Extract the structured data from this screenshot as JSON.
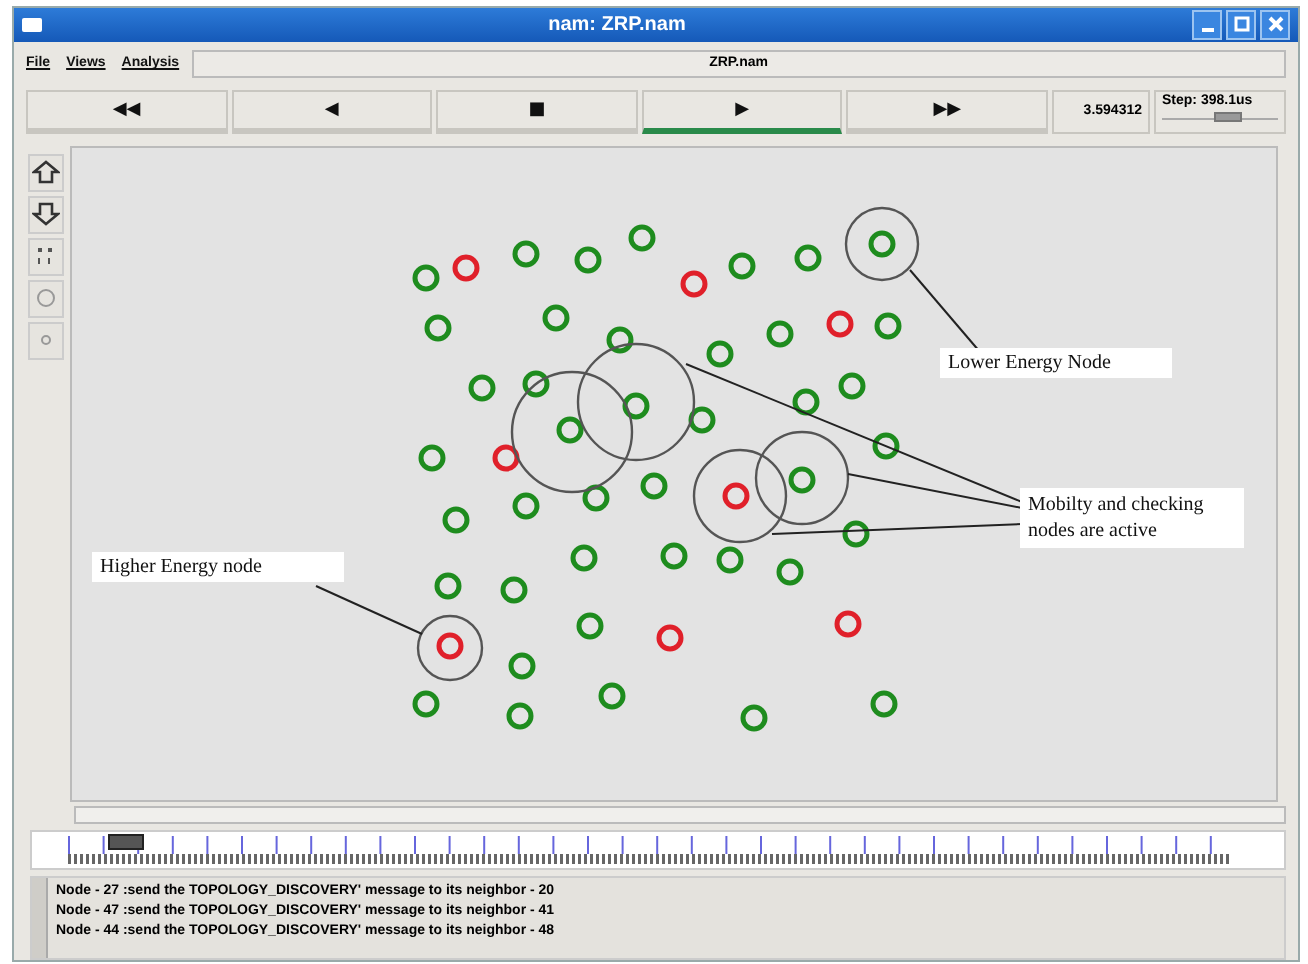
{
  "window": {
    "title": "nam: ZRP.nam"
  },
  "menu": [
    "File",
    "Views",
    "Analysis"
  ],
  "file_label": "ZRP.nam",
  "controls": [
    {
      "label": "◀◀",
      "selected": false
    },
    {
      "label": "◀",
      "selected": false
    },
    {
      "label": "■",
      "selected": false
    },
    {
      "label": "▶",
      "selected": true
    },
    {
      "label": "▶▶",
      "selected": false
    }
  ],
  "time": "3.594312",
  "step": "Step: 398.1us",
  "step_slider": {
    "level": 0.55
  },
  "nodes": [
    {
      "color": "#1e8c1e"
    },
    {
      "color": "#e0202a"
    },
    {
      "color": "#1e8c1e"
    },
    {
      "color": "#1e8c1e"
    },
    {
      "color": "#1e8c1e"
    },
    {
      "color": "#e0202a"
    },
    {
      "color": "#1e8c1e"
    },
    {
      "color": "#1e8c1e"
    },
    {
      "color": "#1e8c1e"
    },
    {
      "color": "#1e8c1e"
    },
    {
      "color": "#1e8c1e"
    },
    {
      "color": "#1e8c1e"
    },
    {
      "color": "#1e8c1e"
    },
    {
      "color": "#1e8c1e"
    },
    {
      "color": "#e0202a"
    },
    {
      "color": "#1e8c1e"
    },
    {
      "color": "#1e8c1e"
    },
    {
      "color": "#1e8c1e"
    },
    {
      "color": "#1e8c1e"
    },
    {
      "color": "#1e8c1e"
    },
    {
      "color": "#1e8c1e"
    },
    {
      "color": "#1e8c1e"
    },
    {
      "color": "#1e8c1e"
    },
    {
      "color": "#1e8c1e"
    },
    {
      "color": "#1e8c1e"
    },
    {
      "color": "#e0202a"
    },
    {
      "color": "#e0202a"
    },
    {
      "color": "#1e8c1e"
    },
    {
      "color": "#1e8c1e"
    },
    {
      "color": "#1e8c1e"
    },
    {
      "color": "#1e8c1e"
    },
    {
      "color": "#1e8c1e"
    },
    {
      "color": "#1e8c1e"
    },
    {
      "color": "#1e8c1e"
    },
    {
      "color": "#1e8c1e"
    },
    {
      "color": "#1e8c1e"
    },
    {
      "color": "#1e8c1e"
    },
    {
      "color": "#1e8c1e"
    },
    {
      "color": "#1e8c1e"
    },
    {
      "color": "#e0202a"
    },
    {
      "color": "#1e8c1e"
    },
    {
      "color": "#e0202a"
    },
    {
      "color": "#e0202a"
    },
    {
      "color": "#1e8c1e"
    },
    {
      "color": "#1e8c1e"
    },
    {
      "color": "#1e8c1e"
    },
    {
      "color": "#1e8c1e"
    },
    {
      "color": "#1e8c1e"
    },
    {
      "color": "#1e8c1e"
    }
  ],
  "annotations": [
    "Lower Energy Node",
    "Mobilty and checking nodes are active",
    "Higher Energy node"
  ],
  "timeline": {
    "level": 0.06
  },
  "log": [
    "Node - 27 :send the TOPOLOGY_DISCOVERY' message to its neighbor - 20",
    "Node - 47 :send the TOPOLOGY_DISCOVERY' message to its neighbor - 41",
    "Node - 44 :send the TOPOLOGY_DISCOVERY' message to its neighbor - 48"
  ]
}
